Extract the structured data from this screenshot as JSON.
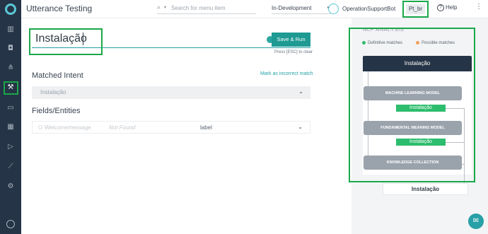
{
  "header": {
    "title": "Utterance Testing",
    "search_placeholder": "Search for menu item",
    "environment": "In-Development",
    "bot_name": "OperationSupportBot",
    "language": "Pt_br",
    "help_label": "Help"
  },
  "utterance": {
    "value": "Instalação",
    "save_run_label": "Save & Run",
    "clear_hint": "Press [ESC] to clear"
  },
  "matched_intent": {
    "title": "Matched Intent",
    "mark_incorrect_label": "Mark as incorrect match",
    "value": "Instalação"
  },
  "fields": {
    "title": "Fields/Entities",
    "rows": [
      {
        "name": "Welcomemessage",
        "status": "Not Found",
        "label": "label"
      }
    ]
  },
  "analysis": {
    "title": "NLP ANALYSIS",
    "legend": [
      {
        "label": "Definitive matches",
        "color": "#2dbd6e"
      },
      {
        "label": "Possible matches",
        "color": "#f0a15a"
      }
    ],
    "result_title": "Instalação",
    "models": [
      {
        "name": "MACHINE LEARNING MODEL",
        "match": "Instalação"
      },
      {
        "name": "FUNDAMENTAL MEANING MODEL",
        "match": "Instalação"
      },
      {
        "name": "KNOWLEDGE COLLECTION",
        "match": ""
      }
    ],
    "final_result": "Instalação"
  },
  "colors": {
    "rail": "#253446",
    "accent": "#1f9a93",
    "highlight": "#1aa84a",
    "match": "#2dbd6e"
  }
}
